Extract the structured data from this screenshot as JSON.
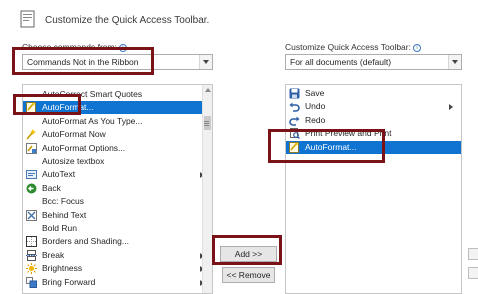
{
  "header": {
    "title": "Customize the Quick Access Toolbar."
  },
  "left": {
    "label": "Choose commands from:",
    "dropdown_value": "Commands Not in the Ribbon",
    "items": [
      {
        "label": "AutoCorrect Smart Quotes",
        "icon": "blank-icon"
      },
      {
        "label": "AutoFormat...",
        "icon": "autoformat-icon",
        "selected": true
      },
      {
        "label": "AutoFormat As You Type...",
        "icon": "blank-icon"
      },
      {
        "label": "AutoFormat Now",
        "icon": "autoformat-now-icon"
      },
      {
        "label": "AutoFormat Options...",
        "icon": "autoformat-options-icon"
      },
      {
        "label": "Autosize textbox",
        "icon": "blank-icon"
      },
      {
        "label": "AutoText",
        "icon": "autotext-icon",
        "submenu": true
      },
      {
        "label": "Back",
        "icon": "back-arrow-icon"
      },
      {
        "label": "Bcc: Focus",
        "icon": "blank-icon"
      },
      {
        "label": "Behind Text",
        "icon": "behind-text-icon"
      },
      {
        "label": "Bold Run",
        "icon": "blank-icon"
      },
      {
        "label": "Borders and Shading...",
        "icon": "borders-icon"
      },
      {
        "label": "Break",
        "icon": "break-icon",
        "submenu": true
      },
      {
        "label": "Brightness",
        "icon": "brightness-icon",
        "submenu": true
      },
      {
        "label": "Bring Forward",
        "icon": "bring-forward-icon",
        "submenu": true
      }
    ]
  },
  "right": {
    "label": "Customize Quick Access Toolbar:",
    "dropdown_value": "For all documents (default)",
    "items": [
      {
        "label": "Save",
        "icon": "save-icon"
      },
      {
        "label": "Undo",
        "icon": "undo-icon",
        "submenu": true
      },
      {
        "label": "Redo",
        "icon": "redo-icon"
      },
      {
        "label": "Print Preview and Print",
        "icon": "print-preview-icon"
      },
      {
        "label": "AutoFormat...",
        "icon": "autoformat-icon",
        "selected": true
      }
    ]
  },
  "buttons": {
    "add": "Add >>",
    "remove": "<< Remove"
  },
  "colors": {
    "selection": "#0f73d1",
    "annotation": "#7a1218"
  }
}
